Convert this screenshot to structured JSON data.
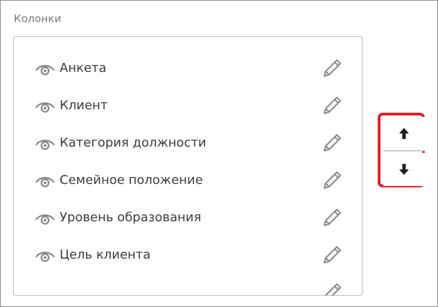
{
  "panel": {
    "title": "Колонки"
  },
  "columns": [
    {
      "label": "Анкета",
      "visible_icon": "eye-icon",
      "edit_icon": "pencil-icon"
    },
    {
      "label": "Клиент",
      "visible_icon": "eye-icon",
      "edit_icon": "pencil-icon"
    },
    {
      "label": "Категория должности",
      "visible_icon": "eye-icon",
      "edit_icon": "pencil-icon"
    },
    {
      "label": "Семейное положение",
      "visible_icon": "eye-icon",
      "edit_icon": "pencil-icon"
    },
    {
      "label": "Уровень образования",
      "visible_icon": "eye-icon",
      "edit_icon": "pencil-icon"
    },
    {
      "label": "Цель клиента",
      "visible_icon": "eye-icon",
      "edit_icon": "pencil-icon"
    }
  ],
  "order_controls": {
    "up_icon": "arrow-up-icon",
    "down_icon": "arrow-down-icon",
    "highlight_color": "#e0202c"
  },
  "colors": {
    "icon": "#8c8c8c",
    "text": "#3d3d3d",
    "title": "#7a7a7a"
  }
}
